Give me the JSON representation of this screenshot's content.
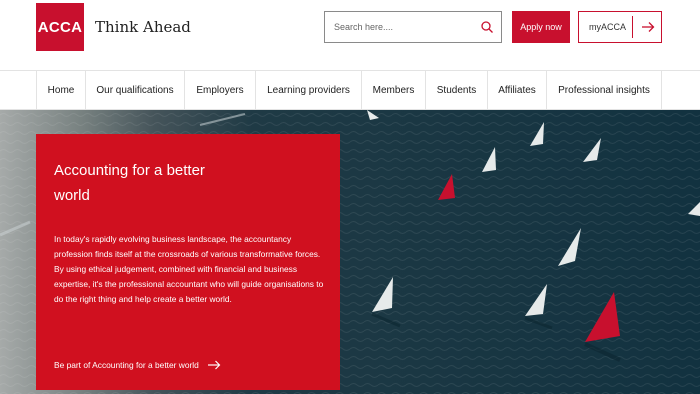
{
  "header": {
    "logo_text": "ACCA",
    "tagline": "Think Ahead",
    "search": {
      "placeholder": "Search here...."
    },
    "apply_label": "Apply now",
    "myacca_label": "myACCA"
  },
  "nav": {
    "items": [
      {
        "label": "Home"
      },
      {
        "label": "Our qualifications"
      },
      {
        "label": "Employers"
      },
      {
        "label": "Learning providers"
      },
      {
        "label": "Members"
      },
      {
        "label": "Students"
      },
      {
        "label": "Affiliates"
      },
      {
        "label": "Professional insights"
      }
    ]
  },
  "hero": {
    "title": "Accounting for a better world",
    "body": "In today's rapidly evolving business landscape, the accountancy profession finds itself at the crossroads of various transformative forces. By using ethical judgement, combined with financial and business expertise, it's the professional accountant who will guide organisations to do the right thing and help create a better world.",
    "link_label": "Be part of Accounting for a better world"
  },
  "icons": {
    "search": "search-icon",
    "myacca_arrow": "arrow-right-icon",
    "link_arrow": "arrow-right-icon"
  },
  "colors": {
    "brand_red": "#c8102e",
    "promo_red": "#d0101f",
    "sea": "#173541"
  }
}
